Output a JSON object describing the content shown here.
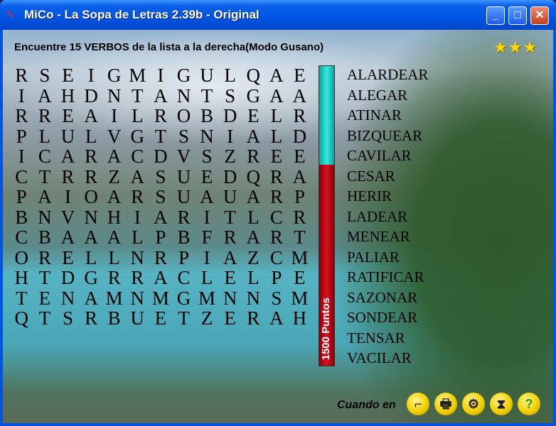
{
  "window": {
    "title": "MiCo - La Sopa de Letras 2.39b - Original",
    "icon": "mico-icon"
  },
  "header": {
    "instruction": "Encuentre 15 VERBOS de la lista a la derecha(Modo Gusano)",
    "stars": "★★★",
    "star_count": 3
  },
  "grid": [
    "RSEIGMIGULQAE",
    "IAHDNTANTSGAA",
    "RREAILROBDELR",
    "PLULVGTSNIALD",
    "ICARACDVSZREE",
    "CTRRZASUEDQRA",
    "PAIOARSUAUARP",
    "BNVNHIARITLCR",
    "CBAAALPBFRART",
    "ORELLNRPIAZCM",
    "HTDGRRACLELPE",
    "TENAMNMGMNNSM",
    "QTSRBUETZERAH"
  ],
  "score": {
    "label": "1500 Puntos",
    "bar_remaining_fraction": 0.33,
    "colors": {
      "remaining": "#1ec8c0",
      "elapsed": "#c0101c"
    }
  },
  "words": [
    "ALARDEAR",
    "ALEGAR",
    "ATINAR",
    "BIZQUEAR",
    "CAVILAR",
    "CESAR",
    "HERIR",
    "LADEAR",
    "MENEAR",
    "PALIAR",
    "RATIFICAR",
    "SAZONAR",
    "SONDEAR",
    "TENSAR",
    "VACILAR"
  ],
  "footer": {
    "label": "Cuando en",
    "buttons": [
      {
        "icon": "golf-club-icon",
        "glyph": "⌐"
      },
      {
        "icon": "printer-icon",
        "glyph": "🖶"
      },
      {
        "icon": "settings-icon",
        "glyph": "⚙"
      },
      {
        "icon": "hourglass-icon",
        "glyph": "⧗"
      },
      {
        "icon": "help-icon",
        "glyph": "?"
      }
    ]
  }
}
